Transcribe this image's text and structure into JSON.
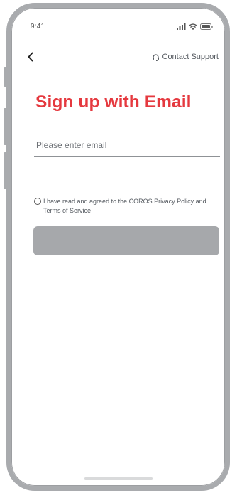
{
  "status_bar": {
    "time": "9:41",
    "icons": [
      "signal-icon",
      "wifi-icon",
      "battery-icon"
    ]
  },
  "nav": {
    "back_icon": "chevron-left-icon",
    "support_icon": "headset-icon",
    "support_label": "Contact Support"
  },
  "page": {
    "title": "Sign up with Email"
  },
  "email": {
    "value": "",
    "placeholder": "Please enter email"
  },
  "agreement": {
    "checked": false,
    "text": "I have read and agreed to the COROS Privacy Policy and Terms of Service"
  },
  "submit": {
    "label": "",
    "enabled": false
  },
  "colors": {
    "accent": "#e5393f",
    "disabled_button": "#a6a8ab",
    "frame": "#a9abae"
  }
}
